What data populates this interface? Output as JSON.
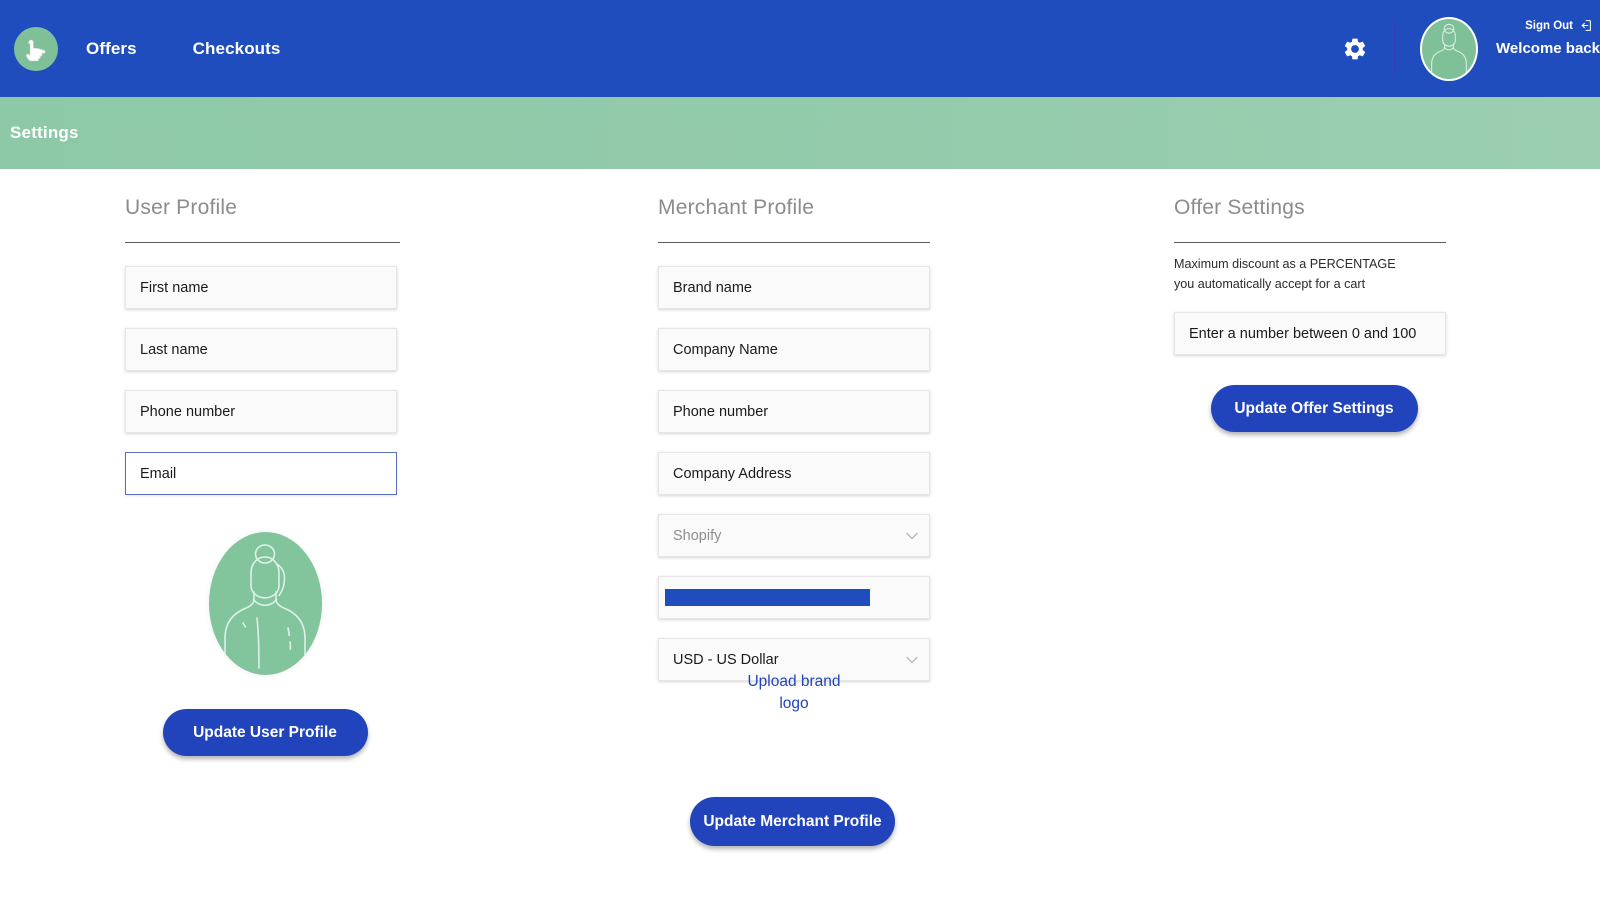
{
  "colors": {
    "header_blue": "#1f4dbe",
    "subheader_green": "#8ec9a7",
    "button_blue": "#2144bd",
    "link_blue": "#2144bd",
    "avatar_green": "#82c49c",
    "selection_blue": "#1f4dbe"
  },
  "header": {
    "logo_icon": "pointing-hand-logo-icon",
    "nav": [
      {
        "label": "Offers"
      },
      {
        "label": "Checkouts"
      }
    ],
    "settings_icon": "gear-icon",
    "avatar_icon": "person-avatar-icon",
    "welcome_text": "Welcome back",
    "signout_label": "Sign Out",
    "signout_icon": "sign-out-icon"
  },
  "subheader": {
    "title": "Settings"
  },
  "user_profile": {
    "title": "User Profile",
    "fields": [
      {
        "name": "first-name",
        "placeholder": "First name",
        "value": "",
        "focused": false
      },
      {
        "name": "last-name",
        "placeholder": "Last name",
        "value": "",
        "focused": false
      },
      {
        "name": "phone-number",
        "placeholder": "Phone number",
        "value": "",
        "focused": false
      },
      {
        "name": "email",
        "placeholder": "Email",
        "value": "",
        "focused": true
      }
    ],
    "avatar_icon": "user-profile-avatar-icon",
    "submit_label": "Update User Profile"
  },
  "merchant_profile": {
    "title": "Merchant Profile",
    "fields": [
      {
        "name": "brand-name",
        "placeholder": "Brand name",
        "value": ""
      },
      {
        "name": "company-name",
        "placeholder": "Company Name",
        "value": ""
      },
      {
        "name": "phone-number",
        "placeholder": "Phone number",
        "value": ""
      },
      {
        "name": "company-address",
        "placeholder": "Company Address",
        "value": ""
      }
    ],
    "platform_select": {
      "value": "Shopify",
      "options": [
        "Shopify"
      ]
    },
    "store_url_field": {
      "value": "",
      "selected": true
    },
    "currency_select": {
      "value": "USD - US Dollar",
      "options": [
        "USD - US Dollar"
      ]
    },
    "upload_link_line1": "Upload brand",
    "upload_link_line2": "logo",
    "submit_label": "Update Merchant Profile"
  },
  "offer_settings": {
    "title": "Offer Settings",
    "description": "Maximum discount as a PERCENTAGE you automatically accept for a cart",
    "input_placeholder": "Enter a number between 0 and 100",
    "input_value": "",
    "submit_label": "Update Offer Settings"
  }
}
